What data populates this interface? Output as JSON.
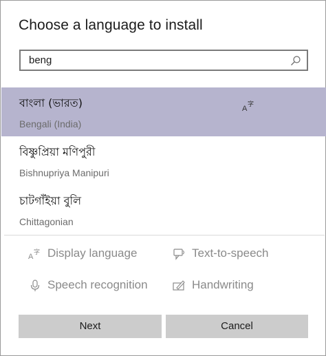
{
  "dialog": {
    "title": "Choose a language to install",
    "search": {
      "value": "beng"
    },
    "languages": [
      {
        "native": "বাংলা (ভারত)",
        "english": "Bengali (India)",
        "selected": true,
        "features": [
          "display-language-icon"
        ]
      },
      {
        "native": "বিষ্ণুপ্রিয়া মণিপুরী",
        "english": "Bishnupriya Manipuri",
        "selected": false,
        "features": []
      },
      {
        "native": "চাটগাঁইয়া বুলি",
        "english": "Chittagonian",
        "selected": false,
        "features": []
      }
    ],
    "legend": {
      "display_language": "Display language",
      "text_to_speech": "Text-to-speech",
      "speech_recognition": "Speech recognition",
      "handwriting": "Handwriting"
    },
    "buttons": {
      "next": "Next",
      "cancel": "Cancel"
    },
    "colors": {
      "selected_bg": "#b6b4ce",
      "button_bg": "#cccccc",
      "muted_text": "#8a8a8a"
    }
  }
}
